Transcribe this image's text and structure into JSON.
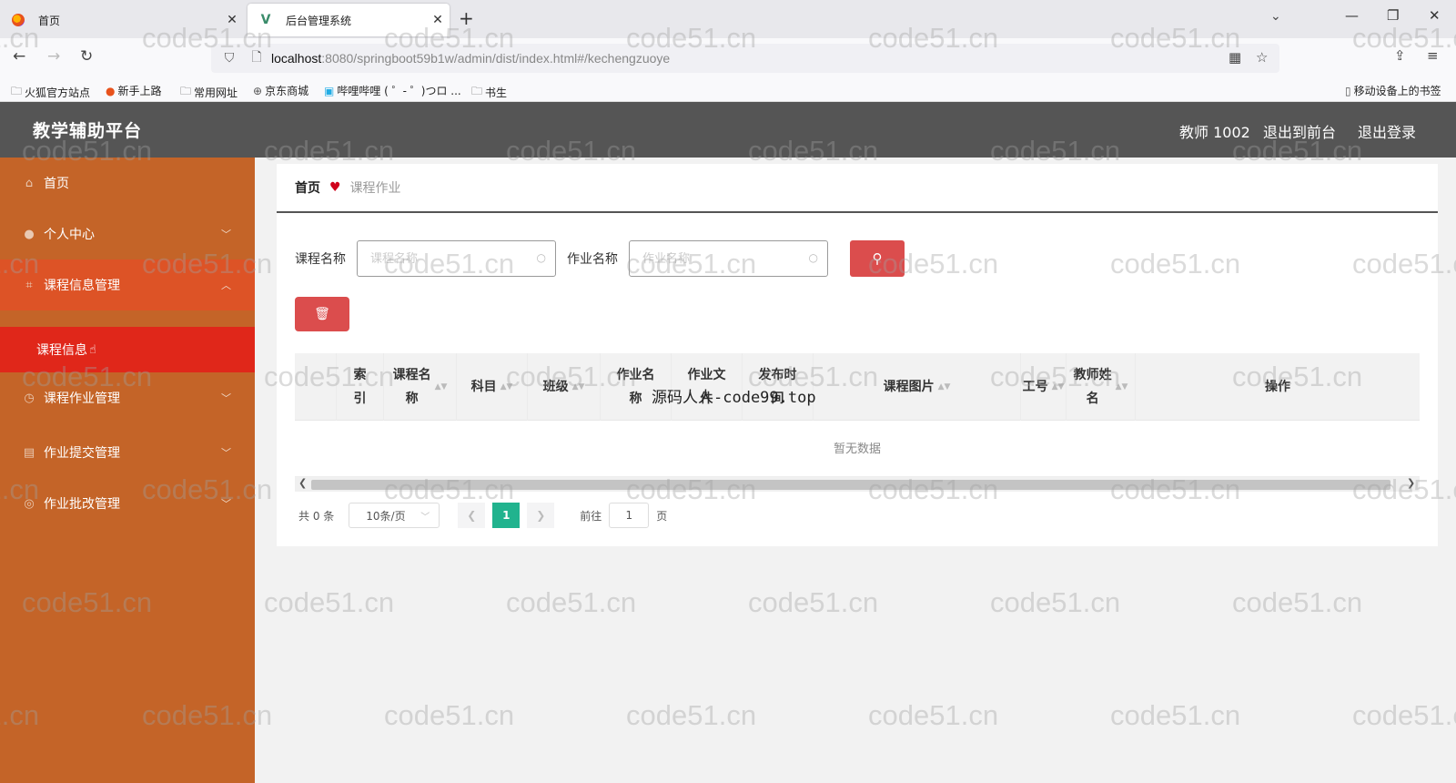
{
  "browser": {
    "tabs": [
      {
        "title": "首页",
        "active": false
      },
      {
        "title": "后台管理系统",
        "active": true
      }
    ],
    "url_host": "localhost",
    "url_rest": ":8080/springboot59b1w/admin/dist/index.html#/kechengzuoye",
    "bookmarks": [
      "火狐官方站点",
      "新手上路",
      "常用网址",
      "京东商城",
      "哔哩哔哩 ( ゜- ゜)つロ ...",
      "书生",
      "移动设备上的书签"
    ]
  },
  "header": {
    "brand": "教学辅助平台",
    "user": "教师 1002",
    "to_front": "退出到前台",
    "logout": "退出登录"
  },
  "sidebar": {
    "items": [
      {
        "label": "首页",
        "icon": "home-icon"
      },
      {
        "label": "个人中心",
        "icon": "user-icon"
      },
      {
        "label": "课程信息管理",
        "icon": "crop-icon"
      },
      {
        "label": "课程作业管理",
        "icon": "clock-icon"
      },
      {
        "label": "作业提交管理",
        "icon": "archive-icon"
      },
      {
        "label": "作业批改管理",
        "icon": "globe-icon"
      }
    ],
    "sub_active": "课程信息"
  },
  "breadcrumb": {
    "home": "首页",
    "current": "课程作业"
  },
  "search": {
    "label1": "课程名称",
    "placeholder1": "课程名称",
    "label2": "作业名称",
    "placeholder2": "作业名称"
  },
  "table": {
    "columns": [
      "索\n引",
      "课程名\n称",
      "科目",
      "班级",
      "作业名\n称",
      "作业文\n件",
      "发布时\n间",
      "课程图片",
      "工号",
      "教师姓\n名",
      "操作"
    ],
    "empty_text": "暂无数据"
  },
  "pager": {
    "total": "共 0 条",
    "page_size": "10条/页",
    "current": "1",
    "goto_label": "前往",
    "goto_value": "1",
    "page_suffix": "页"
  },
  "watermark_text": "源码人人-code99.top",
  "wm_tile": "code51.cn",
  "colors": {
    "sidebar": "#c46428",
    "sidebar_active": "#e0271a",
    "header": "#555555",
    "accent": "#db4d4d",
    "pager_active": "#21b38e"
  }
}
